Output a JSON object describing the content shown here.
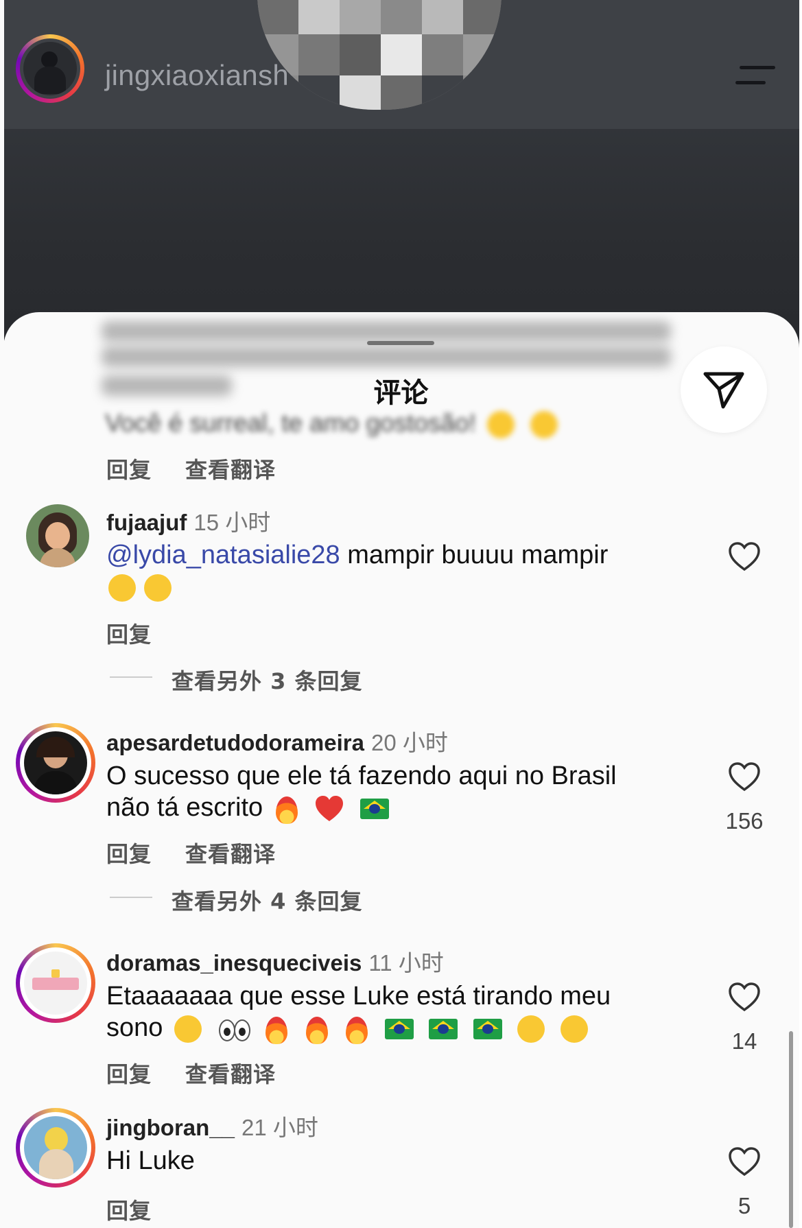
{
  "header": {
    "username": "jingxiaoxiansh"
  },
  "sheet": {
    "title": "评论",
    "pinned": {
      "text_visible": "Você é surreal, te amo gostosão!",
      "reply_label": "回复",
      "translate_label": "查看翻译"
    }
  },
  "comments": [
    {
      "username": "fujaajuf",
      "time": "15 小时",
      "mention": "@lydia_natasialie28",
      "text": " mampir buuuu mampir",
      "reply_label": "回复",
      "more_replies": "查看另外 3 条回复"
    },
    {
      "username": "apesardetudodorameira",
      "time": "20 小时",
      "text_line1": "O sucesso que ele tá fazendo aqui no Brasil",
      "text_line2": "não tá escrito",
      "likes": "156",
      "reply_label": "回复",
      "translate_label": "查看翻译",
      "more_replies": "查看另外 4 条回复"
    },
    {
      "username": "doramas_inesqueciveis",
      "time": "11 小时",
      "text_line1": "Etaaaaaaa que esse Luke está tirando meu",
      "text_line2": "sono",
      "likes": "14",
      "reply_label": "回复",
      "translate_label": "查看翻译"
    },
    {
      "username": "jingboran__",
      "time": "21 小时",
      "text": "Hi Luke",
      "likes": "5",
      "reply_label": "回复"
    }
  ],
  "colors": {
    "mention": "#3949a8",
    "sheet_bg": "#fafafa",
    "video_bg": "#2b2d31"
  },
  "icons": {
    "share": "paper-plane-icon",
    "like": "heart-outline-icon",
    "menu": "hamburger-menu-icon"
  }
}
